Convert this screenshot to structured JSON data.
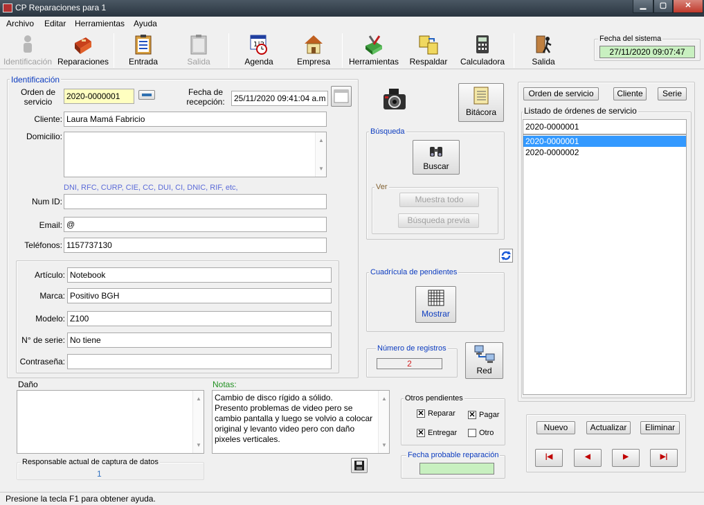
{
  "window": {
    "title": "CP Reparaciones para 1",
    "min": "▁",
    "max": "▢",
    "close": "✕"
  },
  "menu": [
    "Archivo",
    "Editar",
    "Herramientas",
    "Ayuda"
  ],
  "toolbar": {
    "identificacion": "Identificación",
    "reparaciones": "Reparaciones",
    "entrada": "Entrada",
    "salida_disabled": "Salida",
    "agenda": "Agenda",
    "empresa": "Empresa",
    "herramientas": "Herramientas",
    "respaldar": "Respaldar",
    "calculadora": "Calculadora",
    "salida": "Salida",
    "agenda_icon_text": "1|2"
  },
  "system_date": {
    "label": "Fecha del sistema",
    "value": "27/11/2020 09:07:47"
  },
  "identificacion": {
    "legend": "Identificación",
    "orden_label": "Orden de servicio",
    "orden_value": "2020-0000001",
    "fecha_label": "Fecha de recepción:",
    "fecha_value": "25/11/2020 09:41:04 a.m",
    "cliente_label": "Cliente:",
    "cliente_value": "Laura Mamá Fabricio",
    "domicilio_label": "Domicilio:",
    "domicilio_value": "",
    "id_hint": "DNI, RFC, CURP, CIE, CC, DUI, CI, DNIC, RIF, etc,",
    "numid_label": "Num ID:",
    "numid_value": "",
    "email_label": "Email:",
    "email_value": "@",
    "telefonos_label": "Teléfonos:",
    "telefonos_value": "1157737130"
  },
  "equipo": {
    "articulo_label": "Artículo:",
    "articulo_value": "Notebook",
    "marca_label": "Marca:",
    "marca_value": "Positivo BGH",
    "modelo_label": "Modelo:",
    "modelo_value": "Z100",
    "serie_label": "N° de serie:",
    "serie_value": "No tiene",
    "contrasena_label": "Contraseña:",
    "contrasena_value": ""
  },
  "dano": {
    "label": "Daño",
    "value": ""
  },
  "notas": {
    "label": "Notas:",
    "lines": [
      "Cambio de disco rígido a sólido.",
      "Presento problemas de video pero se",
      "cambio pantalla y luego se volvio a colocar",
      "original y levanto video pero con daño",
      "pixeles verticales."
    ]
  },
  "responsable": {
    "label": "Responsable actual de captura de datos",
    "value": "1"
  },
  "bitacora": "Bitácora",
  "busqueda": {
    "legend": "Búsqueda",
    "buscar": "Buscar",
    "ver_legend": "Ver",
    "muestra_todo": "Muestra todo",
    "busqueda_previa": "Búsqueda previa"
  },
  "cuadricula": {
    "legend": "Cuadrícula de pendientes",
    "mostrar": "Mostrar"
  },
  "registros": {
    "legend": "Número de registros",
    "value": "2"
  },
  "red": "Red",
  "otros": {
    "legend": "Otros pendientes",
    "reparar": "Reparar",
    "pagar": "Pagar",
    "entregar": "Entregar",
    "otro": "Otro",
    "check_mark": "✕"
  },
  "fecha_probable": {
    "legend": "Fecha probable reparación",
    "value": ""
  },
  "right_panel": {
    "tab_orden": "Orden de servicio",
    "tab_cliente": "Cliente",
    "tab_serie": "Serie",
    "listado_legend": "Listado de órdenes de servicio",
    "search_value": "2020-0000001",
    "items": [
      "2020-0000001",
      "2020-0000002"
    ],
    "nuevo": "Nuevo",
    "actualizar": "Actualizar",
    "eliminar": "Eliminar",
    "nav_first": "|◀",
    "nav_prev": "◀",
    "nav_next": "▶",
    "nav_last": "▶|"
  },
  "colors": {
    "accent_blue": "#0b3bbf",
    "highlight_yellow": "#ffffc0",
    "date_green": "#c8f0c0"
  },
  "status": "Presione la tecla F1 para obtener ayuda."
}
